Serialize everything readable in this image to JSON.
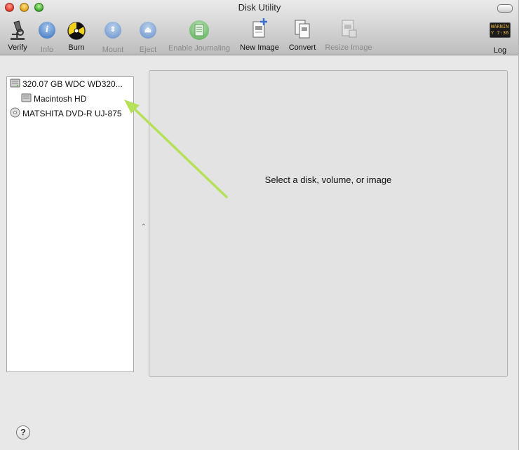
{
  "window": {
    "title": "Disk Utility"
  },
  "toolbar": {
    "verify": "Verify",
    "info": "Info",
    "burn": "Burn",
    "mount": "Mount",
    "eject": "Eject",
    "journaling": "Enable Journaling",
    "new_image": "New Image",
    "convert": "Convert",
    "resize_image": "Resize Image",
    "log": "Log",
    "log_icon_text": "WARNIN",
    "log_icon_text2": "Y 7:36"
  },
  "sidebar": {
    "items": [
      {
        "label": "320.07 GB WDC WD320..."
      },
      {
        "label": "Macintosh HD"
      },
      {
        "label": "MATSHITA DVD-R UJ-875"
      }
    ]
  },
  "main": {
    "message": "Select a disk, volume, or image"
  },
  "help": {
    "label": "?"
  },
  "annotation": {
    "arrow_color": "#b5e05a"
  }
}
